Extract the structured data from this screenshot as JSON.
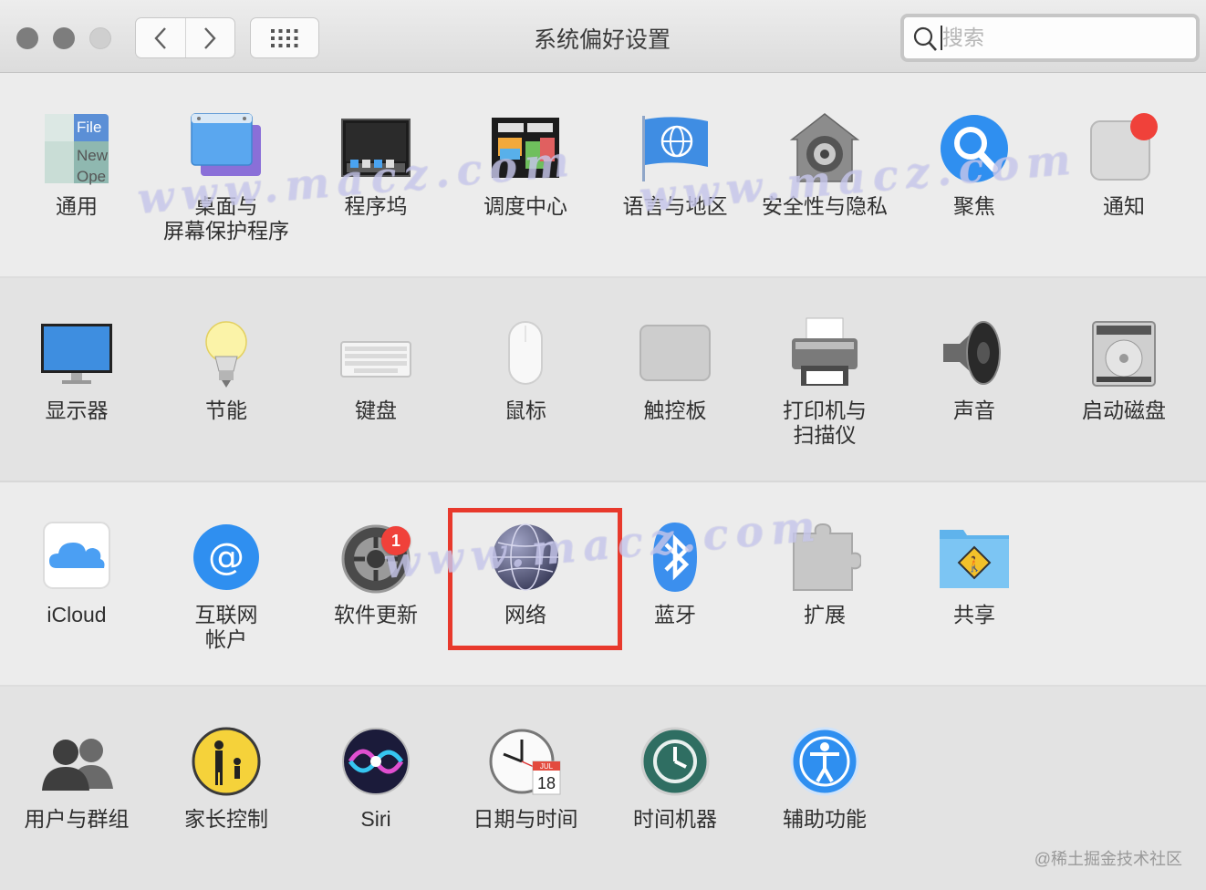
{
  "window": {
    "title": "系统偏好设置",
    "search": {
      "placeholder": "搜索",
      "value": ""
    },
    "nav": {
      "back": "chevron-left-icon",
      "forward": "chevron-right-icon",
      "show_all": "grid-icon"
    }
  },
  "rows": [
    {
      "items": [
        {
          "name": "general",
          "label": "通用",
          "icon": "general-icon"
        },
        {
          "name": "desktop-screensaver",
          "label": "桌面与\n屏幕保护程序",
          "icon": "desktop-icon"
        },
        {
          "name": "dock",
          "label": "程序坞",
          "icon": "dock-icon"
        },
        {
          "name": "mission-control",
          "label": "调度中心",
          "icon": "mission-control-icon"
        },
        {
          "name": "language-region",
          "label": "语言与地区",
          "icon": "globe-flag-icon"
        },
        {
          "name": "security-privacy",
          "label": "安全性与隐私",
          "icon": "house-lock-icon"
        },
        {
          "name": "spotlight",
          "label": "聚焦",
          "icon": "magnifier-icon"
        },
        {
          "name": "notifications",
          "label": "通知",
          "icon": "notification-icon"
        }
      ]
    },
    {
      "items": [
        {
          "name": "displays",
          "label": "显示器",
          "icon": "monitor-icon"
        },
        {
          "name": "energy-saver",
          "label": "节能",
          "icon": "lightbulb-icon"
        },
        {
          "name": "keyboard",
          "label": "键盘",
          "icon": "keyboard-icon"
        },
        {
          "name": "mouse",
          "label": "鼠标",
          "icon": "mouse-icon"
        },
        {
          "name": "trackpad",
          "label": "触控板",
          "icon": "trackpad-icon"
        },
        {
          "name": "printers-scanners",
          "label": "打印机与\n扫描仪",
          "icon": "printer-icon"
        },
        {
          "name": "sound",
          "label": "声音",
          "icon": "speaker-icon"
        },
        {
          "name": "startup-disk",
          "label": "启动磁盘",
          "icon": "hard-disk-icon"
        }
      ]
    },
    {
      "items": [
        {
          "name": "icloud",
          "label": "iCloud",
          "icon": "cloud-icon"
        },
        {
          "name": "internet-accounts",
          "label": "互联网\n帐户",
          "icon": "at-sign-icon"
        },
        {
          "name": "software-update",
          "label": "软件更新",
          "icon": "gear-icon",
          "badge": "1"
        },
        {
          "name": "network",
          "label": "网络",
          "icon": "network-globe-icon"
        },
        {
          "name": "bluetooth",
          "label": "蓝牙",
          "icon": "bluetooth-icon"
        },
        {
          "name": "extensions",
          "label": "扩展",
          "icon": "puzzle-icon"
        },
        {
          "name": "sharing",
          "label": "共享",
          "icon": "sharing-folder-icon"
        }
      ]
    },
    {
      "items": [
        {
          "name": "users-groups",
          "label": "用户与群组",
          "icon": "users-icon"
        },
        {
          "name": "parental-controls",
          "label": "家长控制",
          "icon": "parental-icon"
        },
        {
          "name": "siri",
          "label": "Siri",
          "icon": "siri-icon"
        },
        {
          "name": "date-time",
          "label": "日期与时间",
          "icon": "clock-calendar-icon",
          "calendar_month": "JUL",
          "calendar_day": "18"
        },
        {
          "name": "time-machine",
          "label": "时间机器",
          "icon": "time-machine-icon"
        },
        {
          "name": "accessibility",
          "label": "辅助功能",
          "icon": "accessibility-icon"
        }
      ]
    }
  ],
  "watermark": [
    "www.macz.com",
    "www.macz.com",
    "www.macz.com"
  ],
  "credit": "@稀土掘金技术社区",
  "colors": {
    "highlight": "#e8392c",
    "badge": "#f0413a",
    "accent": "#2f7ae5"
  }
}
